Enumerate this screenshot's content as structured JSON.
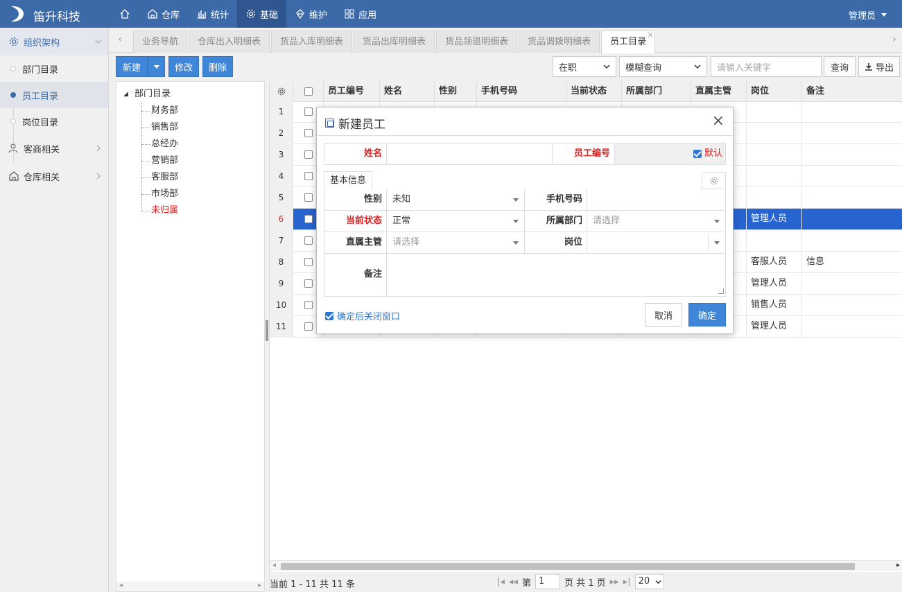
{
  "app": {
    "brand": "笛升科技",
    "user": "管理员"
  },
  "nav": [
    {
      "label": "",
      "icon": "home-icon"
    },
    {
      "label": "仓库",
      "icon": "warehouse-icon"
    },
    {
      "label": "统计",
      "icon": "bar-chart-icon"
    },
    {
      "label": "基础",
      "icon": "gear-icon",
      "active": true
    },
    {
      "label": "维护",
      "icon": "maintenance-icon"
    },
    {
      "label": "应用",
      "icon": "apps-icon"
    }
  ],
  "sidebar": {
    "groups": [
      {
        "label": "组织架构",
        "open": true
      },
      {
        "label": "客商相关"
      },
      {
        "label": "仓库相关"
      }
    ],
    "items": [
      {
        "label": "部门目录"
      },
      {
        "label": "员工目录",
        "active": true
      },
      {
        "label": "岗位目录"
      }
    ]
  },
  "tabs": [
    "业务导航",
    "仓库出入明细表",
    "货品入库明细表",
    "货品出库明细表",
    "货品领退明细表",
    "货品调拨明细表",
    "员工目录"
  ],
  "toolbar": {
    "new_label": "新建",
    "edit_label": "修改",
    "delete_label": "删除",
    "status_filter": "在职",
    "query_mode": "模糊查询",
    "keyword_placeholder": "请输入关键字",
    "query_label": "查询",
    "export_label": "导出"
  },
  "tree": {
    "root": "部门目录",
    "children": [
      "财务部",
      "销售部",
      "总经办",
      "营销部",
      "客服部",
      "市场部",
      "未归属"
    ]
  },
  "grid": {
    "headers": [
      "员工编号",
      "姓名",
      "性别",
      "手机号码",
      "当前状态",
      "所属部门",
      "直属主管",
      "岗位",
      "备注"
    ],
    "rows": [
      {
        "num": "1",
        "post": "",
        "note": ""
      },
      {
        "num": "2",
        "post": "",
        "note": ""
      },
      {
        "num": "3",
        "post": "",
        "note": ""
      },
      {
        "num": "4",
        "post": "",
        "note": ""
      },
      {
        "num": "5",
        "post": "",
        "note": ""
      },
      {
        "num": "6",
        "post": "管理人员",
        "note": "",
        "selected": true
      },
      {
        "num": "7",
        "post": "",
        "note": ""
      },
      {
        "num": "8",
        "post": "客服人员",
        "note": "信息"
      },
      {
        "num": "9",
        "post": "管理人员",
        "note": ""
      },
      {
        "num": "10",
        "post": "销售人员",
        "note": ""
      },
      {
        "num": "11",
        "post": "管理人员",
        "note": ""
      }
    ]
  },
  "pager": {
    "info": "当前 1 - 11 共 11 条",
    "page_prefix": "第",
    "page": "1",
    "page_suffix": "页 共 1 页",
    "size": "20"
  },
  "modal": {
    "title": "新建员工",
    "name_label": "姓名",
    "code_label": "员工编号",
    "default_label": "默认",
    "tab_label": "基本信息",
    "gender_label": "性别",
    "gender_value": "未知",
    "phone_label": "手机号码",
    "status_label": "当前状态",
    "status_value": "正常",
    "dept_label": "所属部门",
    "dept_placeholder": "请选择",
    "manager_label": "直属主管",
    "manager_placeholder": "请选择",
    "post_label": "岗位",
    "note_label": "备注",
    "close_after_label": "确定后关闭窗口",
    "cancel_label": "取消",
    "ok_label": "确定"
  },
  "colors": {
    "primary": "#3c6aa8",
    "button": "#3f86d8",
    "selected_row": "#2864cf",
    "required": "#e02020"
  }
}
